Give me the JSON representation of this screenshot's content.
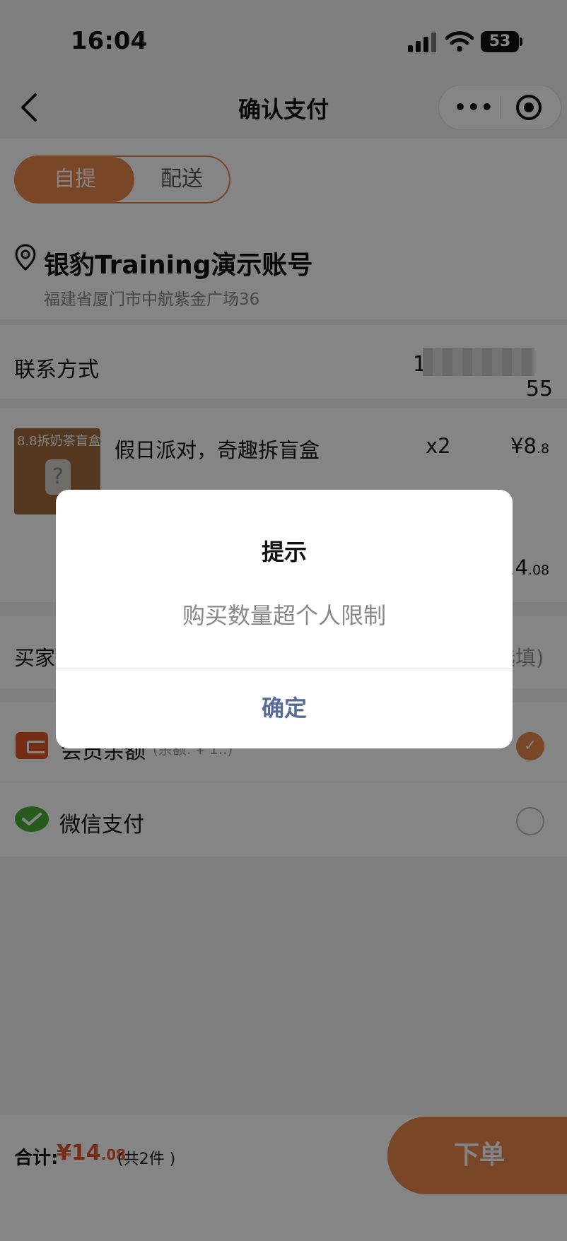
{
  "status_bar": {
    "time": "16:04",
    "battery": "53"
  },
  "nav": {
    "title": "确认支付"
  },
  "mode": {
    "pickup": "自提",
    "delivery": "配送"
  },
  "store": {
    "name": "银豹Training演示账号",
    "address": "福建省厦门市中航紫金广场36"
  },
  "contact": {
    "label": "联系方式",
    "value_start": "14",
    "value_end": "55"
  },
  "product": {
    "thumb_text": "8.8拆奶茶盲盒",
    "thumb_mark": "?",
    "name": "假日派对，奇趣拆盲盒",
    "qty": "x2",
    "price_main": "¥8",
    "price_decimal": ".8"
  },
  "subtotal": {
    "main": "14",
    "decimal": ".08"
  },
  "buyer": {
    "label": "买家",
    "hint": "选填)"
  },
  "payment": {
    "wallet_label": "会员余额",
    "wallet_balance": "(余额: ¥ 1..)",
    "wechat_label": "微信支付",
    "check_mark": "✓"
  },
  "footer": {
    "total_label": "合计:",
    "total_main": "¥14",
    "total_decimal": ".08",
    "count": "(共2件 )",
    "order_button": "下单"
  },
  "dialog": {
    "title": "提示",
    "message": "购买数量超个人限制",
    "confirm": "确定"
  },
  "colors": {
    "accent": "#e8864c",
    "price": "#e2572a",
    "confirm": "#576b95",
    "wechat": "#4cae3a"
  }
}
